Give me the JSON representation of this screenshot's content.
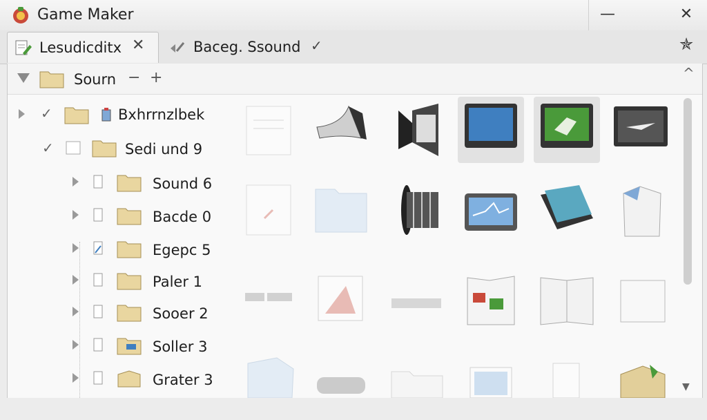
{
  "window": {
    "title": "Game Maker",
    "minimize_icon": "minimize-icon",
    "close_icon": "close-icon"
  },
  "tabs": [
    {
      "label": "Lesudicditx",
      "active": true,
      "close_glyph": "✕"
    },
    {
      "label": "Baceg. Ssound",
      "active": false,
      "check_glyph": "✓"
    }
  ],
  "pin_glyph": "✯",
  "root": {
    "label": "Sourn",
    "minus": "−",
    "plus": "+",
    "collapse_glyph": "^"
  },
  "tree": [
    {
      "label": "Bxhrrnzlbek",
      "checked": true
    },
    {
      "label": "Sedi und 9",
      "checked": true
    },
    {
      "label": "Sound 6"
    },
    {
      "label": "Bacde 0"
    },
    {
      "label": "Egepc 5"
    },
    {
      "label": "Paler 1"
    },
    {
      "label": "Sooer 2"
    },
    {
      "label": "Soller 3"
    },
    {
      "label": "Grater 3"
    }
  ],
  "grid_icons": [
    [
      "document-icon",
      "horn-icon",
      "speaker-icon",
      "monitor-icon",
      "green-monitor-icon",
      "dark-monitor-icon"
    ],
    [
      "document-icon",
      "folder-icon",
      "speaker-cylinder-icon",
      "screen-chart-icon",
      "books-icon",
      "page-icon"
    ],
    [
      "bars-icon",
      "image-icon",
      "keyboard-icon",
      "report-icon",
      "booklet-icon",
      "blank-page-icon"
    ],
    [
      "folder-icon",
      "toggle-icon",
      "folder-icon",
      "picture-icon",
      "page-icon",
      "box-icon"
    ]
  ],
  "colors": {
    "accent_green": "#4a9a3a",
    "screen_blue": "#3f7fc0",
    "folder": "#e9d6a0"
  }
}
